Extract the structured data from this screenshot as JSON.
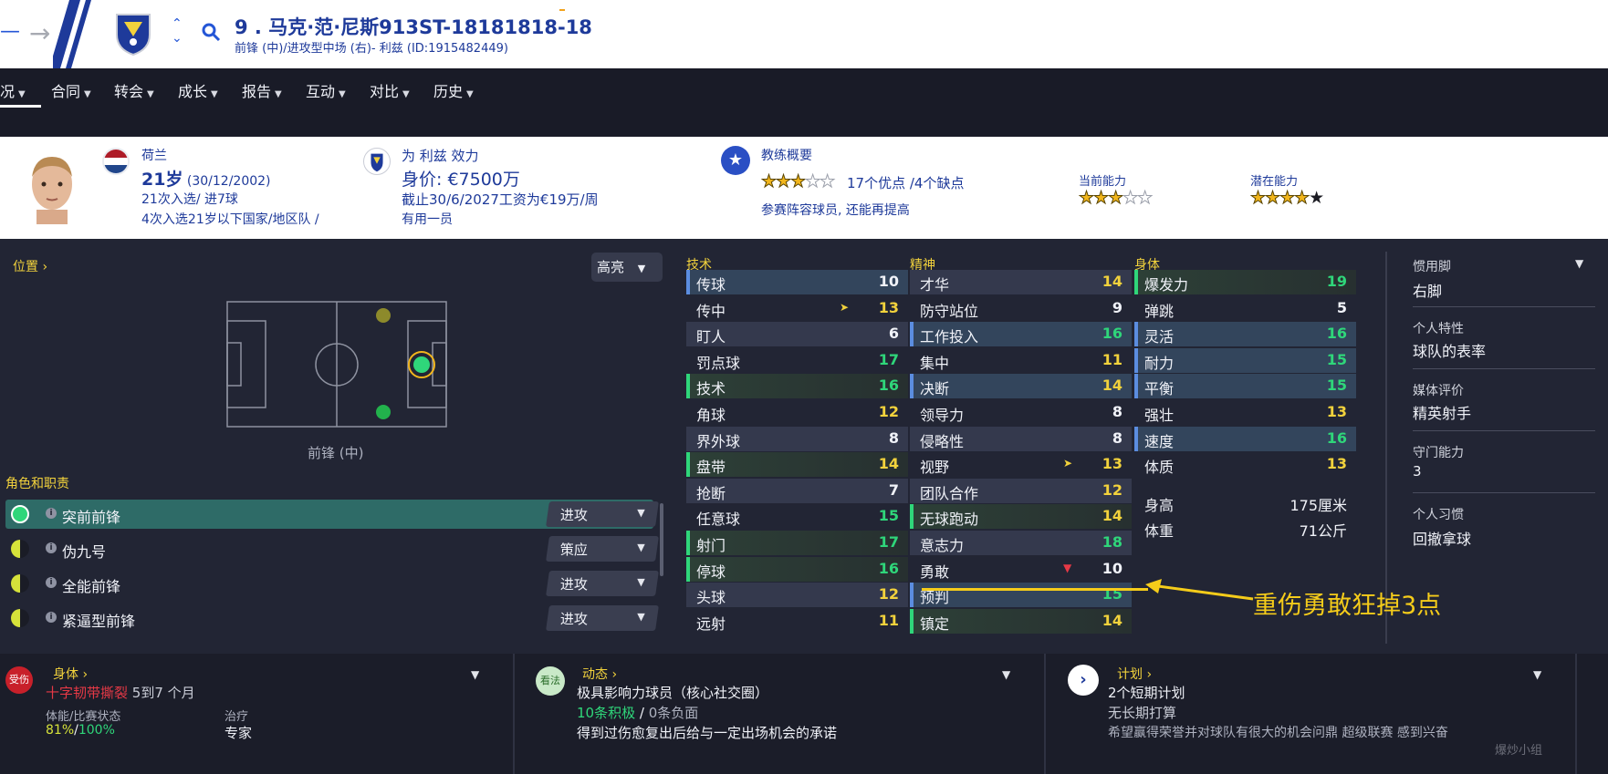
{
  "header": {
    "player_title": "9 . 马克·范·尼斯913ST-18181818-18",
    "subtitle": "前锋 (中)/进攻型中场 (右)- 利兹 (ID:1915482449)"
  },
  "nav": {
    "tabs": [
      "况",
      "合同",
      "转会",
      "成长",
      "报告",
      "互动",
      "对比",
      "历史"
    ]
  },
  "overview": {
    "nation": "荷兰",
    "age": "21岁",
    "dob": "(30/12/2002)",
    "caps": "21次入选/ 进7球",
    "youth_caps": "4次入选21岁以下国家/地区队 /",
    "club_line": "为 利兹 效力",
    "value": "身价: €7500万",
    "contract": "截止30/6/2027工资为€19万/周",
    "squad_status": "有用一员",
    "coach_title": "教练概要",
    "coach_summary": "17个优点 /4个缺点",
    "coach_role": "参赛阵容球员, 还能再提高",
    "current_ability_label": "当前能力",
    "potential_ability_label": "潜在能力",
    "coach_stars": 3,
    "current_stars": 3,
    "potential_stars": 5
  },
  "position": {
    "label": "位置",
    "highlight_btn": "高亮",
    "pos_name": "前锋 (中)",
    "roles_label": "角色和职责",
    "roles": [
      {
        "name": "突前前锋",
        "duty": "进攻",
        "rating": "full"
      },
      {
        "name": "伪九号",
        "duty": "策应",
        "rating": "half"
      },
      {
        "name": "全能前锋",
        "duty": "进攻",
        "rating": "half"
      },
      {
        "name": "紧逼型前锋",
        "duty": "进攻",
        "rating": "half"
      }
    ]
  },
  "attributes": {
    "technical_label": "技术",
    "mental_label": "精神",
    "physical_label": "身体",
    "technical": [
      {
        "name": "传球",
        "value": "10"
      },
      {
        "name": "传中",
        "value": "13"
      },
      {
        "name": "盯人",
        "value": "6"
      },
      {
        "name": "罚点球",
        "value": "17"
      },
      {
        "name": "技术",
        "value": "16"
      },
      {
        "name": "角球",
        "value": "12"
      },
      {
        "name": "界外球",
        "value": "8"
      },
      {
        "name": "盘带",
        "value": "14"
      },
      {
        "name": "抢断",
        "value": "7"
      },
      {
        "name": "任意球",
        "value": "15"
      },
      {
        "name": "射门",
        "value": "17"
      },
      {
        "name": "停球",
        "value": "16"
      },
      {
        "name": "头球",
        "value": "12"
      },
      {
        "name": "远射",
        "value": "11"
      }
    ],
    "mental": [
      {
        "name": "才华",
        "value": "14"
      },
      {
        "name": "防守站位",
        "value": "9"
      },
      {
        "name": "工作投入",
        "value": "16"
      },
      {
        "name": "集中",
        "value": "11"
      },
      {
        "name": "决断",
        "value": "14"
      },
      {
        "name": "领导力",
        "value": "8"
      },
      {
        "name": "侵略性",
        "value": "8"
      },
      {
        "name": "视野",
        "value": "13"
      },
      {
        "name": "团队合作",
        "value": "12"
      },
      {
        "name": "无球跑动",
        "value": "14"
      },
      {
        "name": "意志力",
        "value": "18"
      },
      {
        "name": "勇敢",
        "value": "10"
      },
      {
        "name": "预判",
        "value": "15"
      },
      {
        "name": "镇定",
        "value": "14"
      }
    ],
    "physical": [
      {
        "name": "爆发力",
        "value": "19"
      },
      {
        "name": "弹跳",
        "value": "5"
      },
      {
        "name": "灵活",
        "value": "16"
      },
      {
        "name": "耐力",
        "value": "15"
      },
      {
        "name": "平衡",
        "value": "15"
      },
      {
        "name": "强壮",
        "value": "13"
      },
      {
        "name": "速度",
        "value": "16"
      },
      {
        "name": "体质",
        "value": "13"
      }
    ],
    "height_label": "身高",
    "height": "175厘米",
    "weight_label": "体重",
    "weight": "71公斤"
  },
  "side": {
    "foot_label": "惯用脚",
    "foot": "右脚",
    "trait_label": "个人特性",
    "trait": "球队的表率",
    "media_label": "媒体评价",
    "media": "精英射手",
    "gk_label": "守门能力",
    "gk": "3",
    "habit_label": "个人习惯",
    "habit": "回撤拿球"
  },
  "annotation": "重伤勇敢狂掉3点",
  "bottom": {
    "injury_badge": "受伤",
    "physical_title": "身体",
    "injury": "十字韧带撕裂",
    "injury_time": "5到7 个月",
    "fitness_label": "体能/比赛状态",
    "fitness_a": "81%",
    "fitness_sep": "/",
    "fitness_b": "100%",
    "treatment_label": "治疗",
    "treatment": "专家",
    "views_badge": "看法",
    "dynamics_title": "动态",
    "influence": "极具影响力球员（核心社交圈）",
    "positive": "10条积极",
    "negative_sep": " / ",
    "negative": "0条负面",
    "promise": "得到过伤愈复出后给与一定出场机会的承诺",
    "plan_title": "计划",
    "short_plan": "2个短期计划",
    "long_plan": "无长期打算",
    "ambition": "希望赢得荣誉并对球队有很大的机会问鼎 超级联赛 感到兴奋",
    "watermark": "爆炒小组"
  },
  "colors": {
    "green_val": "#2fd67a",
    "yellow_val": "#f2d23c",
    "white_val": "#f0f2f8",
    "accent": "#1e3a9a"
  }
}
